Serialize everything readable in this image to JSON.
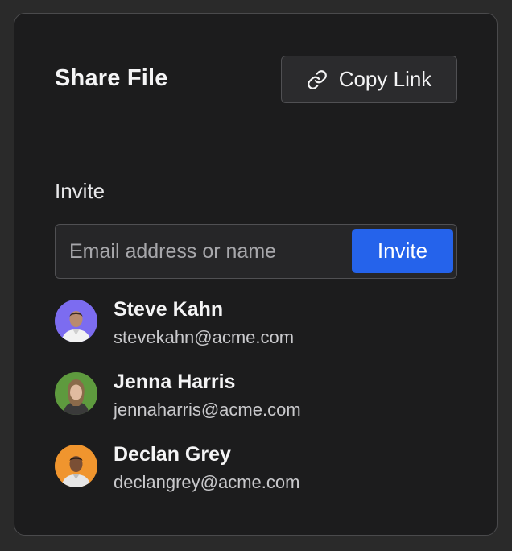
{
  "dialog": {
    "title": "Share File",
    "copy_link_label": "Copy Link"
  },
  "invite": {
    "label": "Invite",
    "placeholder": "Email address or name",
    "value": "",
    "button_label": "Invite"
  },
  "people": [
    {
      "name": "Steve Kahn",
      "email": "stevekahn@acme.com",
      "avatar_color": "#7c6cf0",
      "icon": "avatar-icon"
    },
    {
      "name": "Jenna Harris",
      "email": "jennaharris@acme.com",
      "avatar_color": "#5e9a3e",
      "icon": "avatar-icon"
    },
    {
      "name": "Declan Grey",
      "email": "declangrey@acme.com",
      "avatar_color": "#f0952e",
      "icon": "avatar-icon"
    }
  ],
  "colors": {
    "background": "#1c1c1d",
    "accent": "#2563eb",
    "border": "#505053"
  }
}
